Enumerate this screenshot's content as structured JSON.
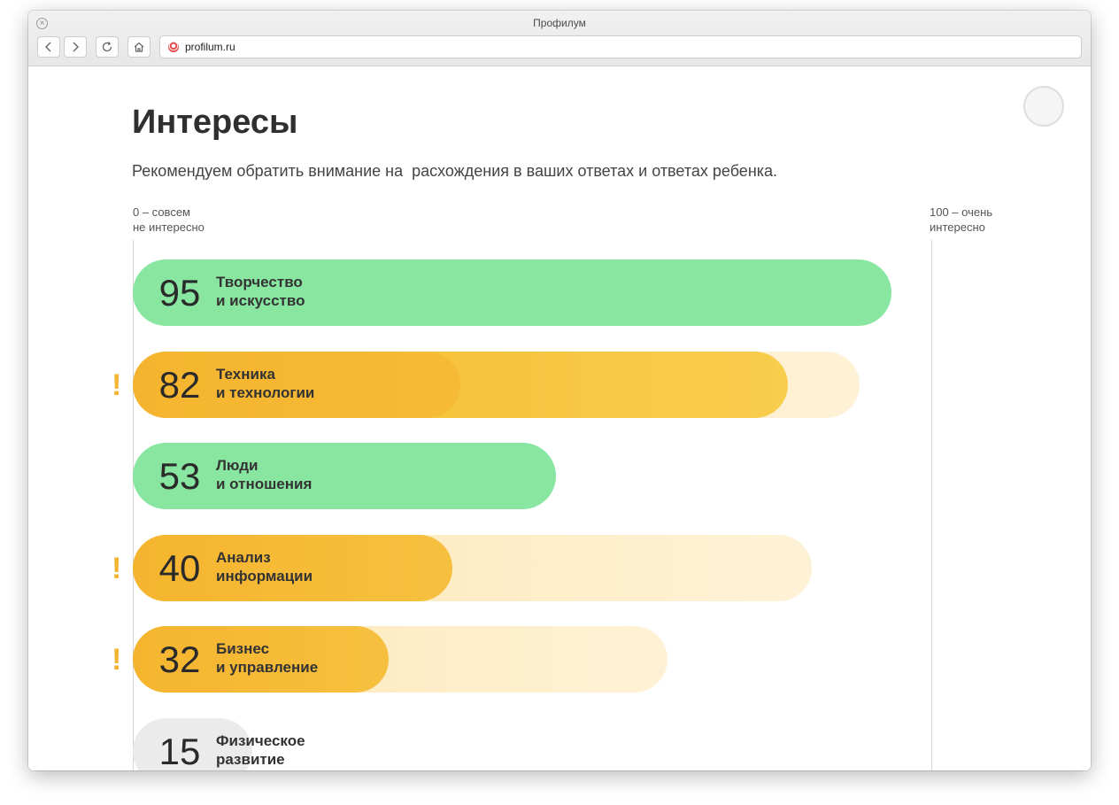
{
  "window": {
    "title": "Профилум"
  },
  "browser": {
    "url": "profilum.ru",
    "back_icon": "chevron-left-icon",
    "forward_icon": "chevron-right-icon",
    "reload_icon": "reload-icon",
    "home_icon": "home-icon"
  },
  "page": {
    "title": "Интересы",
    "subtitle": "Рекомендуем обратить внимание на  расхождения в ваших ответах и ответах ребенка.",
    "scale_min_label": "0 – совсем\nне интересно",
    "scale_max_label": "100 – очень\nинтересно"
  },
  "colors": {
    "green": "#88e6a1",
    "yellow": "#f7c641",
    "ghost": "#feefcf",
    "gray": "#ebebeb",
    "warning": "#f2b431"
  },
  "chart_data": {
    "type": "bar",
    "orientation": "horizontal",
    "xlim": [
      0,
      100
    ],
    "categories": [
      "Творчество\nи искусство",
      "Техника\nи технологии",
      "Люди\nи отношения",
      "Анализ\nинформации",
      "Бизнес\nи управление",
      "Физическое\nразвитие"
    ],
    "series": [
      {
        "values": [
          95,
          82,
          53,
          40,
          32,
          15
        ]
      },
      {
        "values": [
          null,
          91,
          null,
          85,
          67,
          null
        ]
      }
    ],
    "discrepancy_flags": [
      false,
      true,
      false,
      true,
      true,
      false
    ],
    "bar_colors": [
      "green",
      "yellow",
      "green",
      "yellow",
      "yellow",
      "gray"
    ],
    "warning_mark": "!"
  }
}
